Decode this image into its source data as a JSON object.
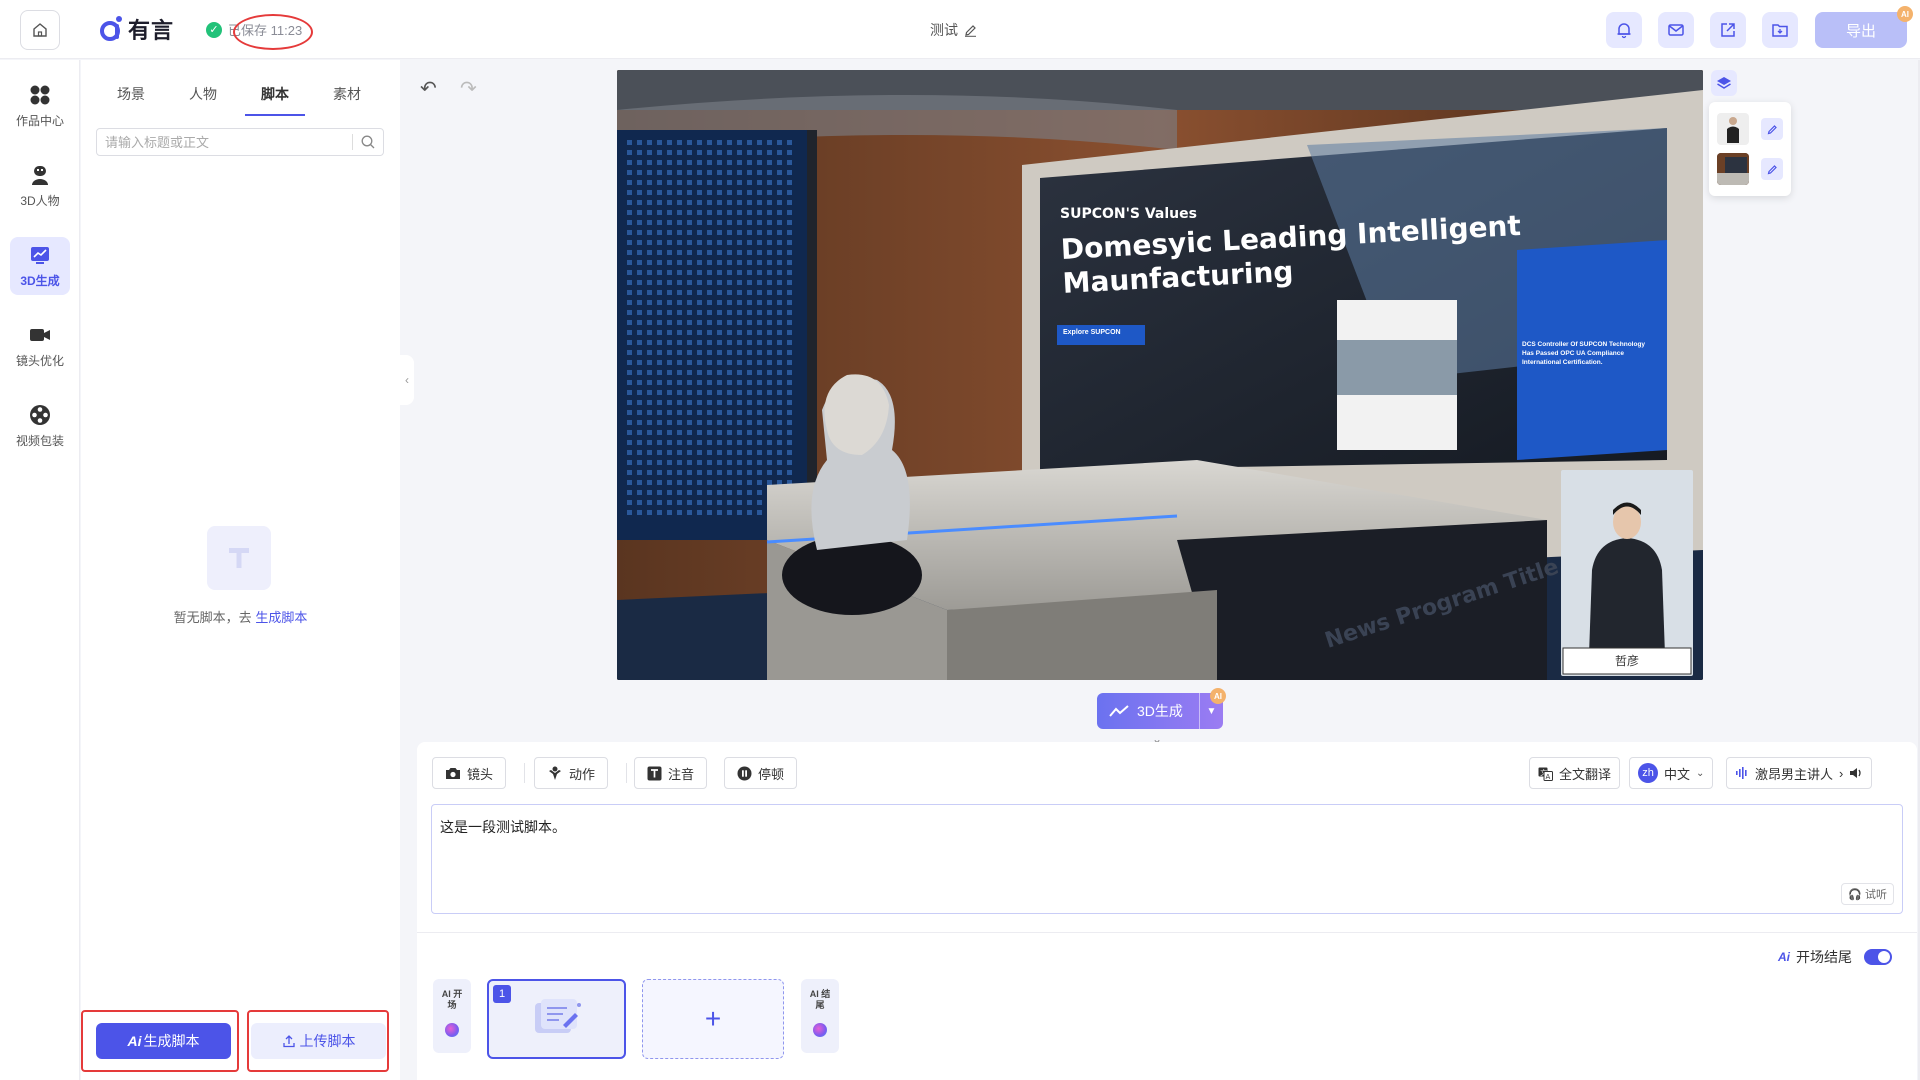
{
  "header": {
    "logo_text": "有言",
    "saved_text": "已保存 11:23",
    "doc_title": "测试",
    "export_label": "导出",
    "export_badge": "AI"
  },
  "rail": {
    "items": [
      {
        "label": "作品中心",
        "icon": "grid-icon"
      },
      {
        "label": "3D人物",
        "icon": "person-icon"
      },
      {
        "label": "3D生成",
        "icon": "chart-icon",
        "active": true
      },
      {
        "label": "镜头优化",
        "icon": "camera-icon"
      },
      {
        "label": "视频包装",
        "icon": "film-reel-icon"
      }
    ]
  },
  "panel": {
    "tabs": [
      "场景",
      "人物",
      "脚本",
      "素材"
    ],
    "active_tab": "脚本",
    "search_placeholder": "请输入标题或正文",
    "empty_text": "暂无脚本，去",
    "empty_link": "生成脚本",
    "ai_generate_label": "生成脚本",
    "ai_prefix": "Ai",
    "upload_label": "上传脚本"
  },
  "preview": {
    "screen_kicker": "SUPCON'S Values",
    "screen_headline_1": "Domesyic Leading Intelligent",
    "screen_headline_2": "Maunfacturing",
    "screen_button": "Explore SUPCON",
    "card_text": "DCS Controller Of SUPCON Technology Has Passed OPC UA Compliance International Certification.",
    "desk_text": "News Program Title",
    "presenter_name": "哲彦"
  },
  "generate": {
    "label": "3D生成",
    "badge": "AI"
  },
  "editor": {
    "tools": [
      {
        "label": "镜头",
        "icon": "camera-icon"
      },
      {
        "label": "动作",
        "icon": "gesture-icon"
      },
      {
        "label": "注音",
        "icon": "text-t-icon"
      },
      {
        "label": "停顿",
        "icon": "pause-icon"
      }
    ],
    "translate_label": "全文翻译",
    "lang_code": "zh",
    "lang_label": "中文",
    "voice_label": "激昂男主讲人",
    "script_text": "这是一段测试脚本。",
    "listen_label": "试听"
  },
  "timeline": {
    "opening_label": "开场结尾",
    "opening_ai": "Ai",
    "intro_card": "AI 开场",
    "outro_card": "AI 结尾",
    "scene_number": "1",
    "add_label": "+"
  },
  "colors": {
    "accent": "#4c54e8",
    "annotation_red": "#e53a3a",
    "saved_green": "#22c279"
  }
}
